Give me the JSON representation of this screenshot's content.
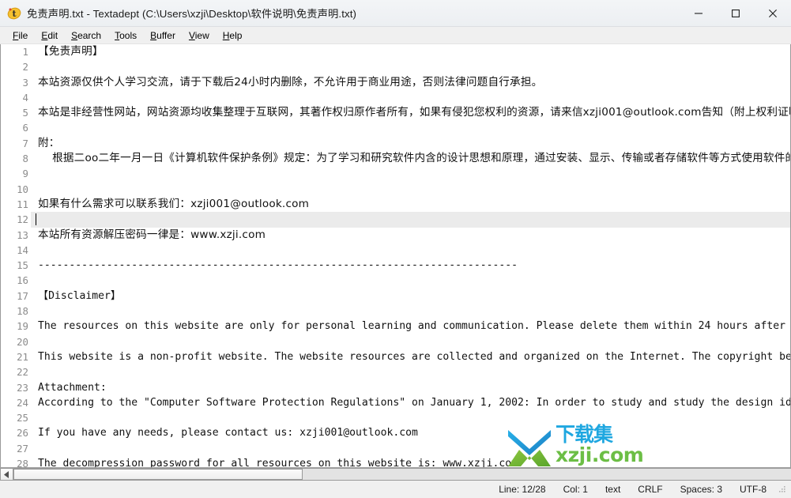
{
  "window": {
    "title": "免责声明.txt - Textadept (C:\\Users\\xzji\\Desktop\\软件说明\\免责声明.txt)",
    "icon": "textadept-app-icon",
    "controls": {
      "minimize": "—",
      "maximize": "□",
      "close": "✕"
    }
  },
  "menubar": {
    "items": [
      {
        "mnemonic": "F",
        "rest": "ile"
      },
      {
        "mnemonic": "E",
        "rest": "dit"
      },
      {
        "mnemonic": "S",
        "rest": "earch"
      },
      {
        "mnemonic": "T",
        "rest": "ools"
      },
      {
        "mnemonic": "B",
        "rest": "uffer"
      },
      {
        "mnemonic": "V",
        "rest": "iew"
      },
      {
        "mnemonic": "H",
        "rest": "elp"
      }
    ]
  },
  "editor": {
    "current_line": 12,
    "lines": [
      {
        "n": "1",
        "text": "【免责声明】",
        "script": "cjk"
      },
      {
        "n": "2",
        "text": "",
        "script": "cjk"
      },
      {
        "n": "3",
        "text": "本站资源仅供个人学习交流，请于下载后24小时内删除，不允许用于商业用途，否则法律问题自行承担。",
        "script": "cjk"
      },
      {
        "n": "4",
        "text": "",
        "script": "cjk"
      },
      {
        "n": "5",
        "text": "本站是非经营性网站，网站资源均收集整理于互联网，其著作权归原作者所有，如果有侵犯您权利的资源，请来信xzji001@outlook.com告知（附上权利证明），我们",
        "script": "cjk"
      },
      {
        "n": "6",
        "text": "",
        "script": "cjk"
      },
      {
        "n": "7",
        "text": "附：",
        "script": "cjk"
      },
      {
        "n": "8",
        "text": "    根据二oo二年一月一日《计算机软件保护条例》规定：为了学习和研究软件内含的设计思想和原理，通过安装、显示、传输或者存储软件等方式使用软件的，可以不",
        "script": "cjk"
      },
      {
        "n": "9",
        "text": "",
        "script": "cjk"
      },
      {
        "n": "10",
        "text": "",
        "script": "cjk"
      },
      {
        "n": "11",
        "text": "如果有什么需求可以联系我们：xzji001@outlook.com",
        "script": "cjk"
      },
      {
        "n": "12",
        "text": "",
        "script": "mono"
      },
      {
        "n": "13",
        "text": "本站所有资源解压密码一律是：www.xzji.com",
        "script": "cjk"
      },
      {
        "n": "14",
        "text": "",
        "script": "cjk"
      },
      {
        "n": "15",
        "text": "-----------------------------------------------------------------------------",
        "script": "mono"
      },
      {
        "n": "16",
        "text": "",
        "script": "mono"
      },
      {
        "n": "17",
        "text": "【Disclaimer】",
        "script": "mono"
      },
      {
        "n": "18",
        "text": "",
        "script": "mono"
      },
      {
        "n": "19",
        "text": "The resources on this website are only for personal learning and communication. Please delete them within 24 hours after downloading. Co",
        "script": "mono"
      },
      {
        "n": "20",
        "text": "",
        "script": "mono"
      },
      {
        "n": "21",
        "text": "This website is a non-profit website. The website resources are collected and organized on the Internet. The copyright belongs to the or",
        "script": "mono"
      },
      {
        "n": "22",
        "text": "",
        "script": "mono"
      },
      {
        "n": "23",
        "text": "Attachment:",
        "script": "mono"
      },
      {
        "n": "24",
        "text": "According to the \"Computer Software Protection Regulations\" on January 1, 2002: In order to study and study the design ideas and princip",
        "script": "mono"
      },
      {
        "n": "25",
        "text": "",
        "script": "mono"
      },
      {
        "n": "26",
        "text": "If you have any needs, please contact us: xzji001@outlook.com",
        "script": "mono"
      },
      {
        "n": "27",
        "text": "",
        "script": "mono"
      },
      {
        "n": "28",
        "text": "The decompression password for all resources on this website is: www.xzji.com",
        "script": "mono"
      }
    ]
  },
  "watermark": {
    "text_top": "下载集",
    "text_bottom": "xzji.com",
    "color_top": "#1fa7e0",
    "color_bottom": "#6cbe45"
  },
  "scrollbar": {
    "left_arrow": "◀",
    "thumb_label": "horizontal-scroll-thumb"
  },
  "statusbar": {
    "line": "Line: 12/28",
    "col": "Col: 1",
    "lexer": "text",
    "eol": "CRLF",
    "indent": "Spaces: 3",
    "encoding": "UTF-8"
  }
}
